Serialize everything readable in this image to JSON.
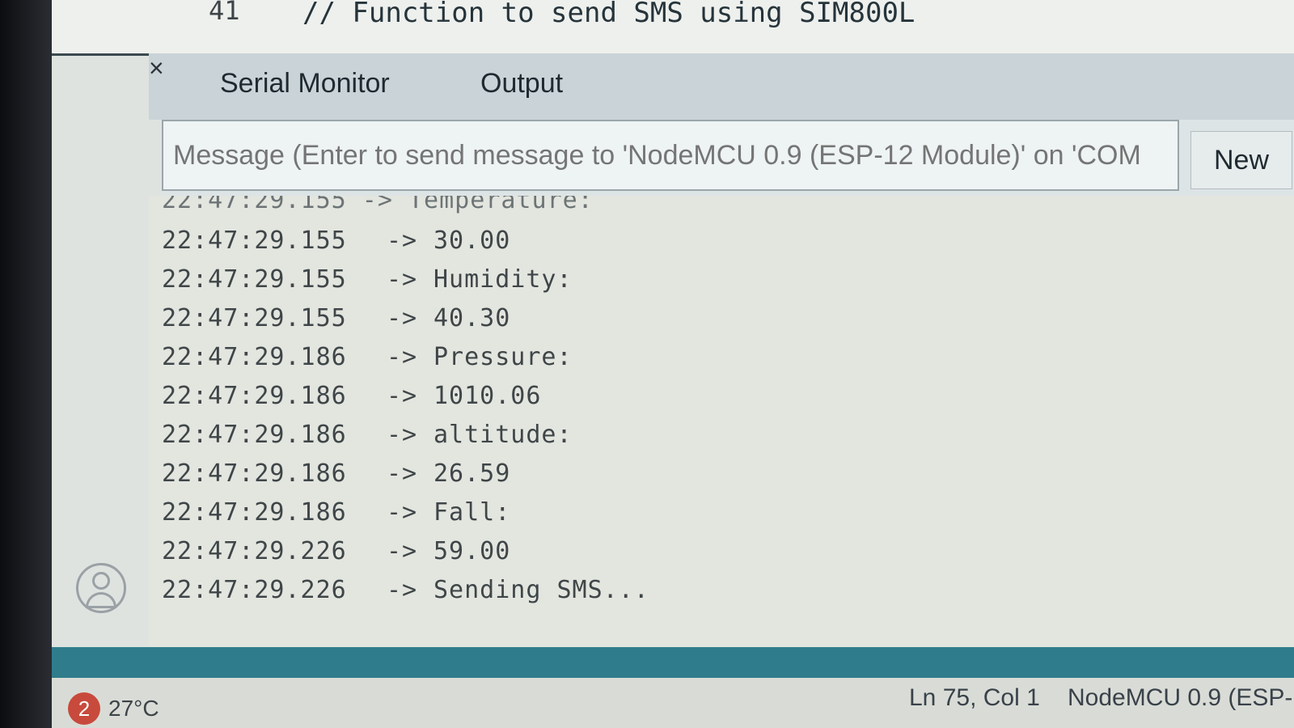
{
  "editor": {
    "line_number": "41",
    "code_line": "// Function to send SMS using SIM800L"
  },
  "tabs": [
    {
      "label": "Serial Monitor",
      "close": "×"
    },
    {
      "label": "Output"
    }
  ],
  "message_input": {
    "placeholder": "Message (Enter to send message to 'NodeMCU 0.9 (ESP-12 Module)' on 'COM"
  },
  "new_button": {
    "label": "New"
  },
  "serial_output": {
    "partial_line": "22:47:29.155 -> Temperature:",
    "lines": [
      {
        "time": "22:47:29.155",
        "arrow": "->",
        "text": "30.00"
      },
      {
        "time": "22:47:29.155",
        "arrow": "->",
        "text": "Humidity:"
      },
      {
        "time": "22:47:29.155",
        "arrow": "->",
        "text": "40.30"
      },
      {
        "time": "22:47:29.186",
        "arrow": "->",
        "text": "Pressure:"
      },
      {
        "time": "22:47:29.186",
        "arrow": "->",
        "text": "1010.06"
      },
      {
        "time": "22:47:29.186",
        "arrow": "->",
        "text": "altitude:"
      },
      {
        "time": "22:47:29.186",
        "arrow": "->",
        "text": "26.59"
      },
      {
        "time": "22:47:29.186",
        "arrow": "->",
        "text": "Fall:"
      },
      {
        "time": "22:47:29.226",
        "arrow": "->",
        "text": "59.00"
      },
      {
        "time": "22:47:29.226",
        "arrow": "->",
        "text": "Sending SMS..."
      }
    ]
  },
  "status_bar": {
    "position": "Ln 75, Col 1",
    "board": "NodeMCU 0.9 (ESP-"
  },
  "taskbar": {
    "badge": "2",
    "temperature": "27°C"
  },
  "icons": {
    "avatar": "account-icon"
  },
  "colors": {
    "status_accent": "#2f7d8c",
    "badge": "#c84a3c"
  }
}
